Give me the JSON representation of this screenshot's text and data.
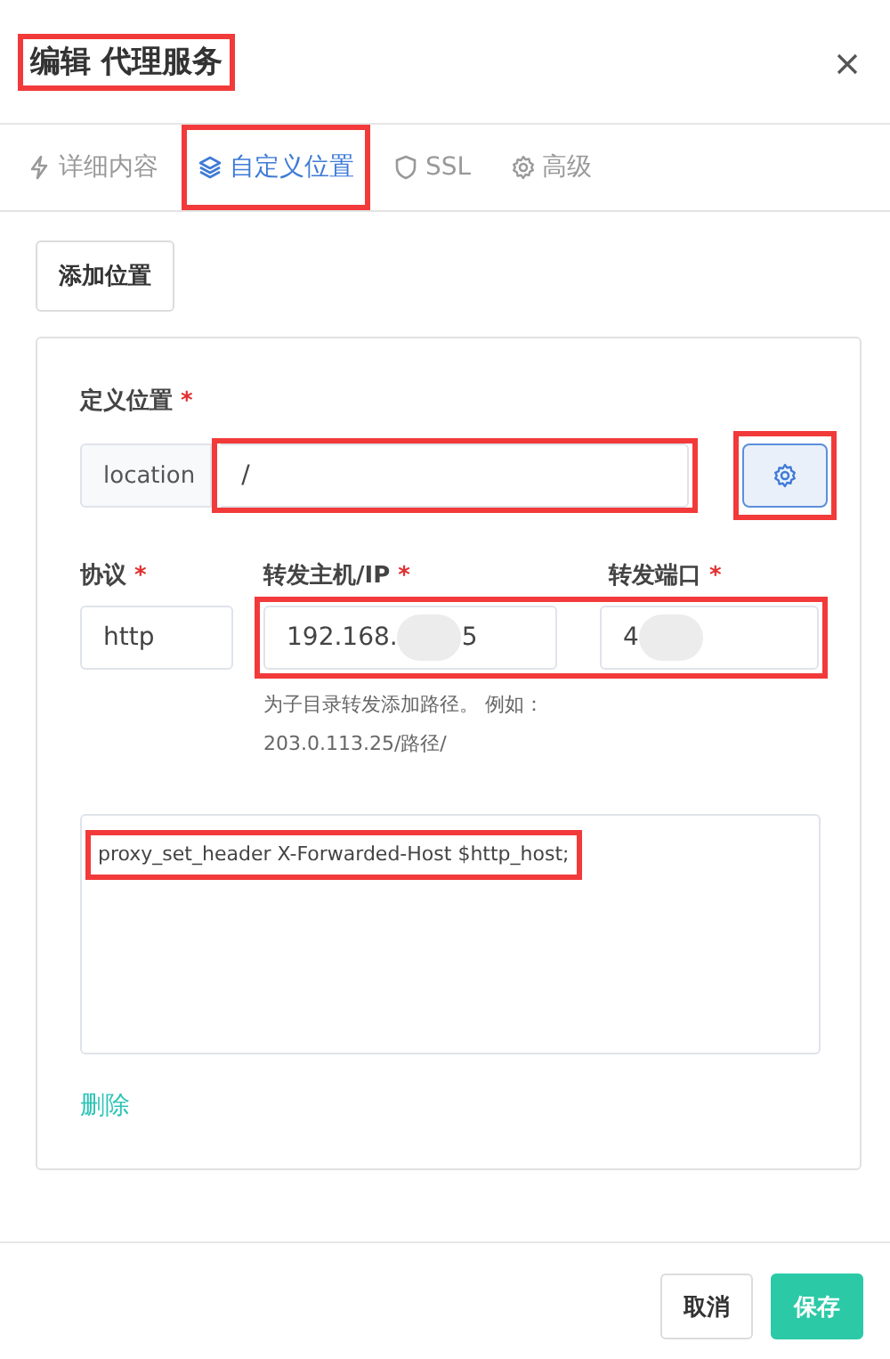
{
  "dialog": {
    "title": "编辑 代理服务",
    "title_highlighted": true
  },
  "tabs": [
    {
      "label": "详细内容",
      "selected": false,
      "highlighted": false
    },
    {
      "label": "自定义位置",
      "selected": true,
      "highlighted": true
    },
    {
      "label": "SSL",
      "selected": false,
      "highlighted": false
    },
    {
      "label": "高级",
      "selected": false,
      "highlighted": false
    }
  ],
  "add_button": "添加位置",
  "location": {
    "label": "定义位置",
    "required": "*",
    "prefix": "location",
    "value": "/",
    "highlighted": true,
    "settings_highlighted": true
  },
  "protocol": {
    "label": "协议",
    "required": "*",
    "value": "http"
  },
  "host": {
    "label": "转发主机/IP",
    "required": "*",
    "value_start": "192.168.",
    "value_end": "5",
    "hint": "为子目录转发添加路径。 例如：203.0.113.25/路径/"
  },
  "port": {
    "label": "转发端口",
    "required": "*",
    "value_start": "4"
  },
  "forward_highlighted": true,
  "config": {
    "value": "proxy_set_header X-Forwarded-Host $http_host;",
    "highlighted": true
  },
  "delete_link": "删除",
  "buttons": [
    {
      "label": "取消",
      "kind": "secondary"
    },
    {
      "label": "保存",
      "kind": "primary"
    }
  ]
}
